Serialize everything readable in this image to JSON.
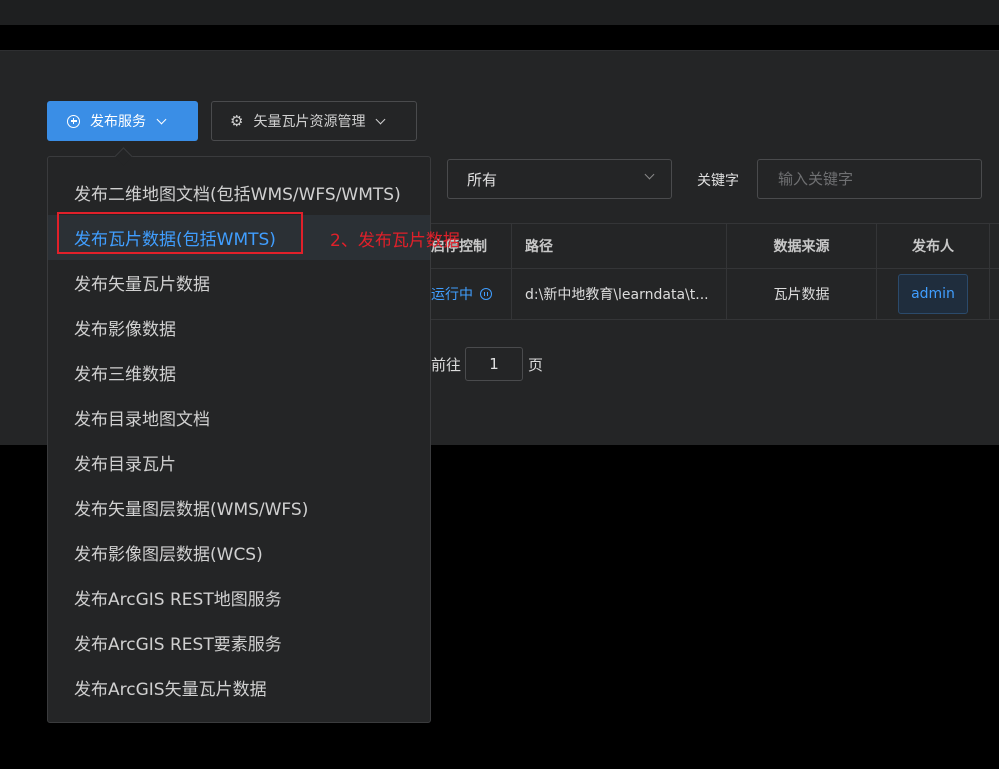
{
  "toolbar": {
    "publish_label": "发布服务",
    "vector_tile_label": "矢量瓦片资源管理"
  },
  "filter": {
    "select_value": "所有",
    "keyword_label": "关键字",
    "keyword_placeholder": "输入关键字"
  },
  "table": {
    "headers": [
      "启停控制",
      "路径",
      "数据来源",
      "发布人"
    ],
    "rows": [
      {
        "status": "运行中",
        "path": "d:\\新中地教育\\learndata\\t...",
        "source": "瓦片数据",
        "publisher": "admin"
      }
    ]
  },
  "pager": {
    "goto_label": "前往",
    "page_value": "1",
    "page_unit": "页"
  },
  "menu": {
    "items": [
      "发布二维地图文档(包括WMS/WFS/WMTS)",
      "发布瓦片数据(包括WMTS)",
      "发布矢量瓦片数据",
      "发布影像数据",
      "发布三维数据",
      "发布目录地图文档",
      "发布目录瓦片",
      "发布矢量图层数据(WMS/WFS)",
      "发布影像图层数据(WCS)",
      "发布ArcGIS REST地图服务",
      "发布ArcGIS REST要素服务",
      "发布ArcGIS矢量瓦片数据"
    ],
    "active_index": 1
  },
  "annotation": {
    "text": "2、发布瓦片数据"
  },
  "colors": {
    "primary": "#3a8ee6",
    "link": "#409eff",
    "annotation": "#e0202a"
  }
}
